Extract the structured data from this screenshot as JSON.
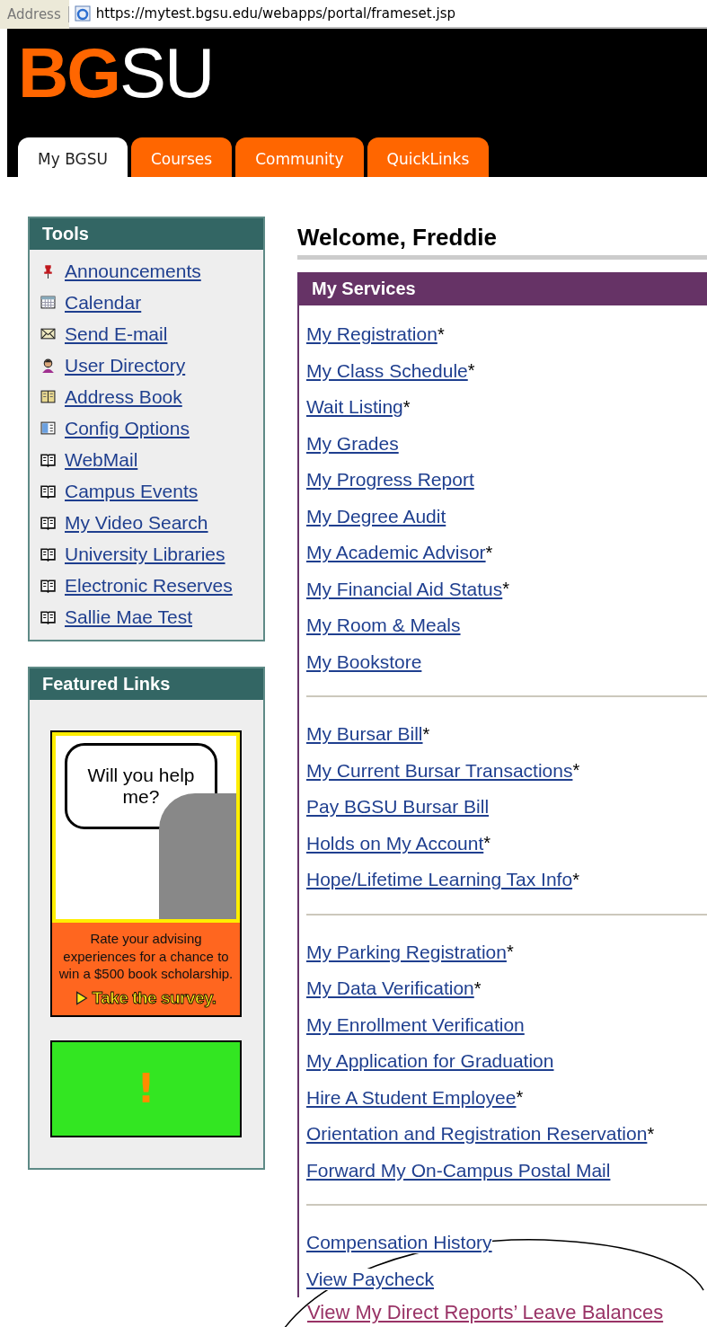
{
  "address_bar": {
    "label": "Address",
    "url": "https://mytest.bgsu.edu/webapps/portal/frameset.jsp"
  },
  "logo": {
    "bold": "BG",
    "light": "SU"
  },
  "tabs": [
    {
      "label": "My BGSU",
      "selected": true
    },
    {
      "label": "Courses",
      "selected": false
    },
    {
      "label": "Community",
      "selected": false
    },
    {
      "label": "QuickLinks",
      "selected": false
    }
  ],
  "tools": {
    "title": "Tools",
    "items": [
      {
        "label": "Announcements",
        "kind": "pushpin"
      },
      {
        "label": "Calendar",
        "kind": "calendar"
      },
      {
        "label": "Send E-mail",
        "kind": "envelope"
      },
      {
        "label": "User Directory",
        "kind": "person"
      },
      {
        "label": "Address Book",
        "kind": "addressbook"
      },
      {
        "label": "Config Options",
        "kind": "card"
      },
      {
        "label": "WebMail",
        "kind": "book"
      },
      {
        "label": "Campus Events",
        "kind": "book"
      },
      {
        "label": "My Video Search",
        "kind": "book"
      },
      {
        "label": "University Libraries",
        "kind": "book"
      },
      {
        "label": "Electronic Reserves",
        "kind": "book"
      },
      {
        "label": "Sallie Mae Test",
        "kind": "book"
      }
    ]
  },
  "featured": {
    "title": "Featured Links",
    "ad": {
      "bubble": "Will you help me?",
      "text": "Rate your advising experiences for a chance to win a $500 book scholarship.",
      "cta": "Take the survey."
    },
    "alert": "!"
  },
  "welcome": "Welcome, Freddie",
  "services": {
    "title": "My Services",
    "groups": [
      [
        {
          "label": "My Registration",
          "note": "*"
        },
        {
          "label": "My Class Schedule",
          "note": "*"
        },
        {
          "label": "Wait Listing",
          "note": "*"
        },
        {
          "label": "My Grades"
        },
        {
          "label": "My Progress Report"
        },
        {
          "label": "My Degree Audit"
        },
        {
          "label": "My Academic Advisor",
          "note": "*"
        },
        {
          "label": "My Financial Aid Status",
          "note": "*"
        },
        {
          "label": "My Room & Meals"
        },
        {
          "label": "My Bookstore"
        }
      ],
      [
        {
          "label": "My Bursar Bill",
          "note": "*"
        },
        {
          "label": "My Current Bursar Transactions",
          "note": "*"
        },
        {
          "label": "Pay BGSU Bursar Bill"
        },
        {
          "label": "Holds on My Account",
          "note": "*"
        },
        {
          "label": "Hope/Lifetime Learning Tax Info",
          "note": "*"
        }
      ],
      [
        {
          "label": "My Parking Registration",
          "note": "*"
        },
        {
          "label": "My Data Verification",
          "note": "*"
        },
        {
          "label": "My Enrollment Verification"
        },
        {
          "label": "My Application for Graduation"
        },
        {
          "label": "Hire A Student Employee",
          "note": "*"
        },
        {
          "label": "Orientation and Registration Reservation",
          "note": "*"
        },
        {
          "label": "Forward My On-Campus Postal Mail"
        }
      ],
      [
        {
          "label": "Compensation History"
        },
        {
          "label": "View Paycheck"
        }
      ]
    ],
    "highlight": "View My Direct Reports’ Leave Balances"
  }
}
